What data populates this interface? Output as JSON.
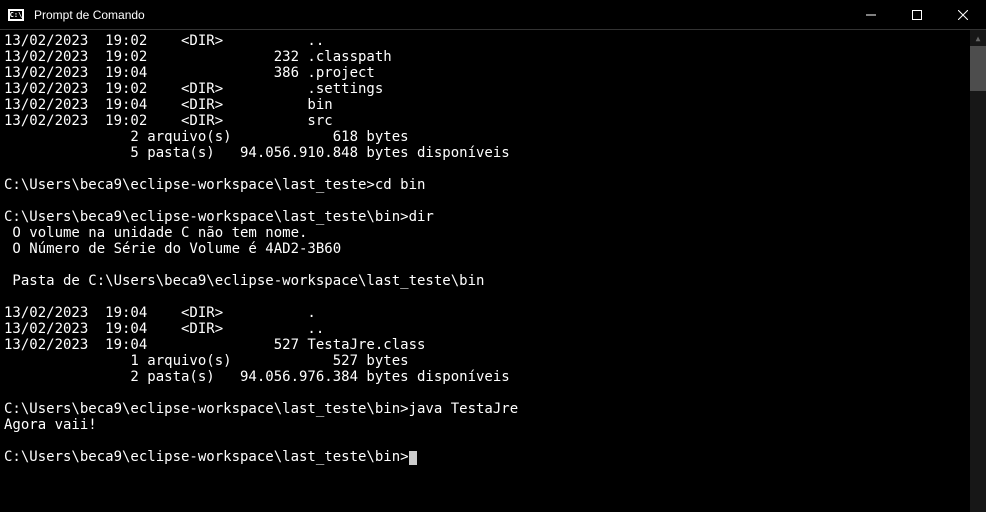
{
  "window": {
    "icon_label": "C:\\",
    "title": "Prompt de Comando"
  },
  "terminal": {
    "lines": [
      "13/02/2023  19:02    <DIR>          ..",
      "13/02/2023  19:02               232 .classpath",
      "13/02/2023  19:04               386 .project",
      "13/02/2023  19:02    <DIR>          .settings",
      "13/02/2023  19:04    <DIR>          bin",
      "13/02/2023  19:02    <DIR>          src",
      "               2 arquivo(s)            618 bytes",
      "               5 pasta(s)   94.056.910.848 bytes disponíveis",
      "",
      "C:\\Users\\beca9\\eclipse-workspace\\last_teste>cd bin",
      "",
      "C:\\Users\\beca9\\eclipse-workspace\\last_teste\\bin>dir",
      " O volume na unidade C não tem nome.",
      " O Número de Série do Volume é 4AD2-3B60",
      "",
      " Pasta de C:\\Users\\beca9\\eclipse-workspace\\last_teste\\bin",
      "",
      "13/02/2023  19:04    <DIR>          .",
      "13/02/2023  19:04    <DIR>          ..",
      "13/02/2023  19:04               527 TestaJre.class",
      "               1 arquivo(s)            527 bytes",
      "               2 pasta(s)   94.056.976.384 bytes disponíveis",
      "",
      "C:\\Users\\beca9\\eclipse-workspace\\last_teste\\bin>java TestaJre",
      "Agora vaii!",
      "",
      "C:\\Users\\beca9\\eclipse-workspace\\last_teste\\bin>"
    ]
  }
}
